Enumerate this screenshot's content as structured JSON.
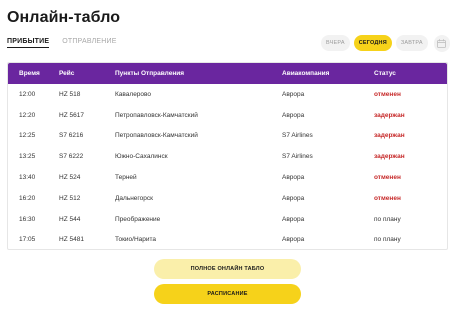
{
  "page": {
    "title": "Онлайн-табло"
  },
  "direction_tabs": [
    {
      "label": "ПРИБЫТИЕ",
      "active": true
    },
    {
      "label": "ОТПРАВЛЕНИЕ",
      "active": false
    }
  ],
  "day_switcher": {
    "days": [
      {
        "label": "ВЧЕРА",
        "active": false
      },
      {
        "label": "СЕГОДНЯ",
        "active": true
      },
      {
        "label": "ЗАВТРА",
        "active": false
      }
    ],
    "calendar_icon": "calendar-icon"
  },
  "table": {
    "headers": {
      "time": "Время",
      "flight": "Рейс",
      "city": "Пункты Отправления",
      "airline": "Авиакомпания",
      "status": "Статус"
    },
    "rows": [
      {
        "time": "12:00",
        "flight": "HZ 518",
        "city": "Кавалерово",
        "airline": "Аврора",
        "status": "отменен",
        "status_kind": "cancelled"
      },
      {
        "time": "12:20",
        "flight": "HZ 5617",
        "city": "Петропавловск-Камчатский",
        "airline": "Аврора",
        "status": "задержан",
        "status_kind": "delayed"
      },
      {
        "time": "12:25",
        "flight": "S7 6216",
        "city": "Петропавловск-Камчатский",
        "airline": "S7 Airlines",
        "status": "задержан",
        "status_kind": "delayed"
      },
      {
        "time": "13:25",
        "flight": "S7 6222",
        "city": "Южно-Сахалинск",
        "airline": "S7 Airlines",
        "status": "задержан",
        "status_kind": "delayed"
      },
      {
        "time": "13:40",
        "flight": "HZ 524",
        "city": "Терней",
        "airline": "Аврора",
        "status": "отменен",
        "status_kind": "cancelled"
      },
      {
        "time": "16:20",
        "flight": "HZ 512",
        "city": "Дальнегорск",
        "airline": "Аврора",
        "status": "отменен",
        "status_kind": "cancelled"
      },
      {
        "time": "16:30",
        "flight": "HZ 544",
        "city": "Преображение",
        "airline": "Аврора",
        "status": "по плану",
        "status_kind": "onschedule"
      },
      {
        "time": "17:05",
        "flight": "HZ 5481",
        "city": "Токио/Нарита",
        "airline": "Аврора",
        "status": "по плану",
        "status_kind": "onschedule"
      }
    ]
  },
  "buttons": {
    "full_board": "ПОЛНОЕ ОНЛАЙН ТАБЛО",
    "schedule": "РАСПИСАНИЕ"
  },
  "colors": {
    "header_bg": "#6a269f",
    "accent_yellow": "#f6d21a",
    "accent_yellow_light": "#faefaa",
    "status_red": "#c62828"
  }
}
